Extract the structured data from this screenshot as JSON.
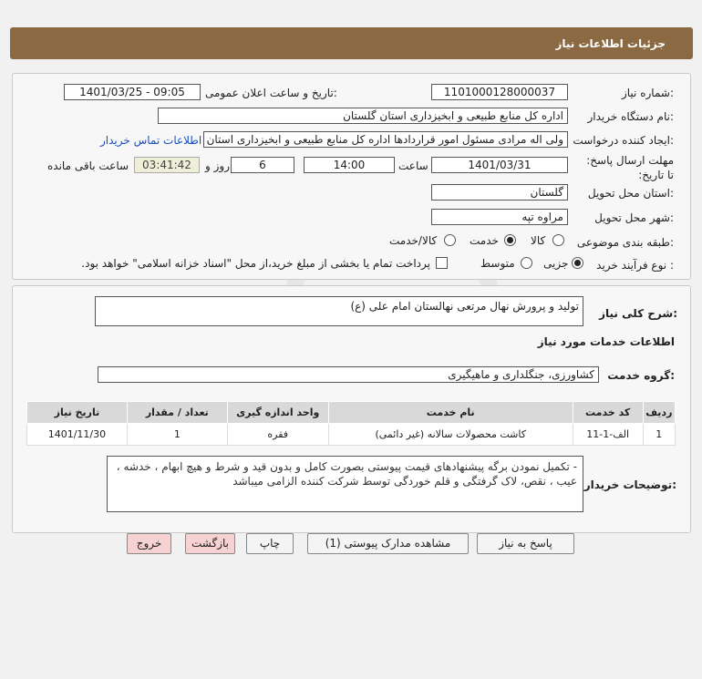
{
  "header": {
    "title": "جزئیات اطلاعات نیاز"
  },
  "fields": {
    "need_number_label": "شماره نیاز:",
    "need_number": "1101000128000037",
    "announce_label": "تاریخ و ساعت اعلان عمومی:",
    "announce_value": "1401/03/25 - 09:05",
    "buyer_org_label": "نام دستگاه خریدار:",
    "buyer_org": "اداره کل منابع طبیعی و ابخیزداری استان گلستان",
    "creator_label": "ایجاد کننده درخواست:",
    "creator": "ولی اله مرادی مسئول امور قراردادها اداره کل منابع طبیعی و ابخیزداری استان گ",
    "contact_link": "اطلاعات تماس خریدار",
    "deadline_label": "مهلت ارسال پاسخ: تا تاریخ:",
    "deadline_date": "1401/03/31",
    "time_label": "ساعت",
    "deadline_time": "14:00",
    "days_value": "6",
    "days_label": "روز و",
    "remaining_time": "03:41:42",
    "remaining_label": "ساعت باقی مانده",
    "province_label": "استان محل تحویل:",
    "province": "گلستان",
    "city_label": "شهر محل تحویل:",
    "city": "مراوه تپه",
    "category_label": "طبقه بندی موضوعی:",
    "category_options": [
      "کالا",
      "خدمت",
      "کالا/خدمت"
    ],
    "process_label": "نوع فرآیند خرید :",
    "process_options": [
      "جزیی",
      "متوسط"
    ],
    "payment_note": "پرداخت تمام یا بخشی از مبلغ خرید،از محل \"اسناد خزانه اسلامی\" خواهد بود."
  },
  "need": {
    "summary_label": "شرح کلی نیاز:",
    "summary": "تولید و پرورش نهال مرتعی نهالستان امام علی (ع)",
    "services_heading": "اطلاعات خدمات مورد نیاز",
    "service_group_label": "گروه خدمت:",
    "service_group": "کشاورزی، جنگلداری و ماهیگیری"
  },
  "table": {
    "headers": [
      "ردیف",
      "کد خدمت",
      "نام خدمت",
      "واحد اندازه گیری",
      "تعداد / مقدار",
      "تاریخ نیاز"
    ],
    "rows": [
      [
        "1",
        "الف-1-11",
        "کاشت محصولات سالانه (غیر دائمی)",
        "فقره",
        "1",
        "1401/11/30"
      ]
    ]
  },
  "buyer_notes": {
    "label": "توضیحات خریدار:",
    "text": "- تکمیل نمودن برگه پیشنهادهای قیمت پیوستی بصورت کامل و بدون قید و شرط و هیچ ابهام ، خدشه ، عیب ، نقص، لاک گرفتگی و قلم خوردگی توسط شرکت کننده الزامی میباشد"
  },
  "buttons": {
    "reply": "پاسخ به نیاز",
    "view_docs": "مشاهده مدارک پیوستی (1)",
    "print": "چاپ",
    "back": "بازگشت",
    "exit": "خروج"
  },
  "watermark": {
    "digits": "0101010",
    "brand": "ParsNamadData"
  },
  "colors": {
    "header": "#8b6a43",
    "link": "#1a4ec0",
    "exit_button": "#f7d2d2"
  }
}
